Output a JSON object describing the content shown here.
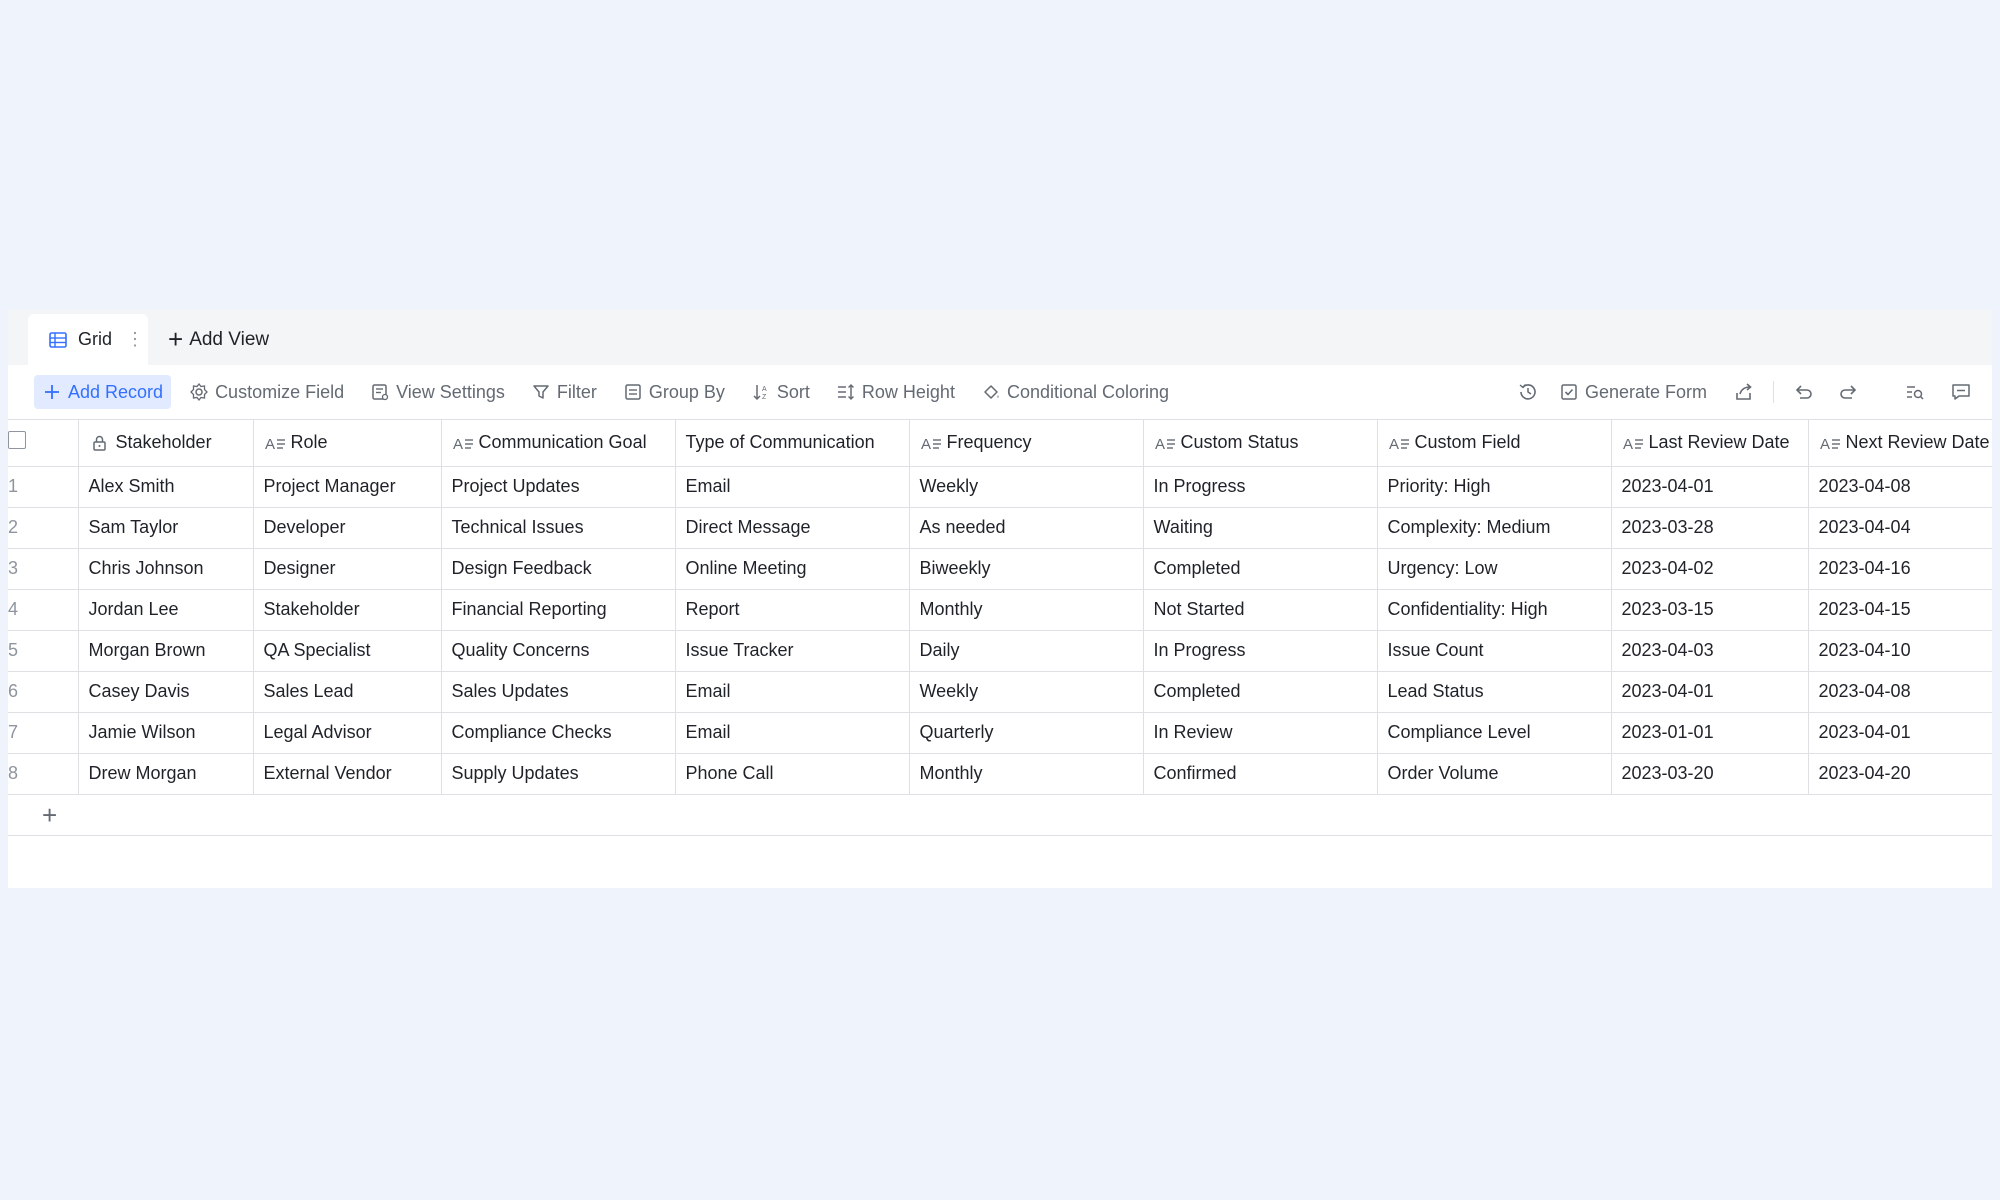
{
  "tabs": {
    "active_label": "Grid",
    "add_view_label": "Add View"
  },
  "toolbar": {
    "add_record": "Add Record",
    "customize_field": "Customize Field",
    "view_settings": "View Settings",
    "filter": "Filter",
    "group_by": "Group By",
    "sort": "Sort",
    "row_height": "Row Height",
    "conditional_coloring": "Conditional Coloring",
    "generate_form": "Generate Form"
  },
  "columns": [
    "Stakeholder",
    "Role",
    "Communication Goal",
    "Type of Communication",
    "Frequency",
    "Custom Status",
    "Custom Field",
    "Last Review Date",
    "Next Review Date"
  ],
  "rows": [
    {
      "num": "1",
      "cells": [
        "Alex Smith",
        "Project Manager",
        "Project Updates",
        "Email",
        "Weekly",
        "In Progress",
        "Priority: High",
        "2023-04-01",
        "2023-04-08"
      ]
    },
    {
      "num": "2",
      "cells": [
        "Sam Taylor",
        "Developer",
        "Technical Issues",
        "Direct Message",
        "As needed",
        "Waiting",
        "Complexity: Medium",
        "2023-03-28",
        "2023-04-04"
      ]
    },
    {
      "num": "3",
      "cells": [
        "Chris Johnson",
        "Designer",
        "Design Feedback",
        "Online Meeting",
        "Biweekly",
        "Completed",
        "Urgency: Low",
        "2023-04-02",
        "2023-04-16"
      ]
    },
    {
      "num": "4",
      "cells": [
        "Jordan Lee",
        "Stakeholder",
        "Financial Reporting",
        "Report",
        "Monthly",
        "Not Started",
        "Confidentiality: High",
        "2023-03-15",
        "2023-04-15"
      ]
    },
    {
      "num": "5",
      "cells": [
        "Morgan Brown",
        "QA Specialist",
        "Quality Concerns",
        "Issue Tracker",
        "Daily",
        "In Progress",
        "Issue Count",
        "2023-04-03",
        "2023-04-10"
      ]
    },
    {
      "num": "6",
      "cells": [
        "Casey Davis",
        "Sales Lead",
        "Sales Updates",
        "Email",
        "Weekly",
        "Completed",
        "Lead Status",
        "2023-04-01",
        "2023-04-08"
      ]
    },
    {
      "num": "7",
      "cells": [
        "Jamie Wilson",
        "Legal Advisor",
        "Compliance Checks",
        "Email",
        "Quarterly",
        "In Review",
        "Compliance Level",
        "2023-01-01",
        "2023-04-01"
      ]
    },
    {
      "num": "8",
      "cells": [
        "Drew Morgan",
        "External Vendor",
        "Supply Updates",
        "Phone Call",
        "Monthly",
        "Confirmed",
        "Order Volume",
        "2023-03-20",
        "2023-04-20"
      ]
    }
  ],
  "colors": {
    "accent": "#3370ff",
    "accent_bg": "#e1eaff",
    "page_bg": "#eff4fc",
    "border": "#dee0e3"
  }
}
